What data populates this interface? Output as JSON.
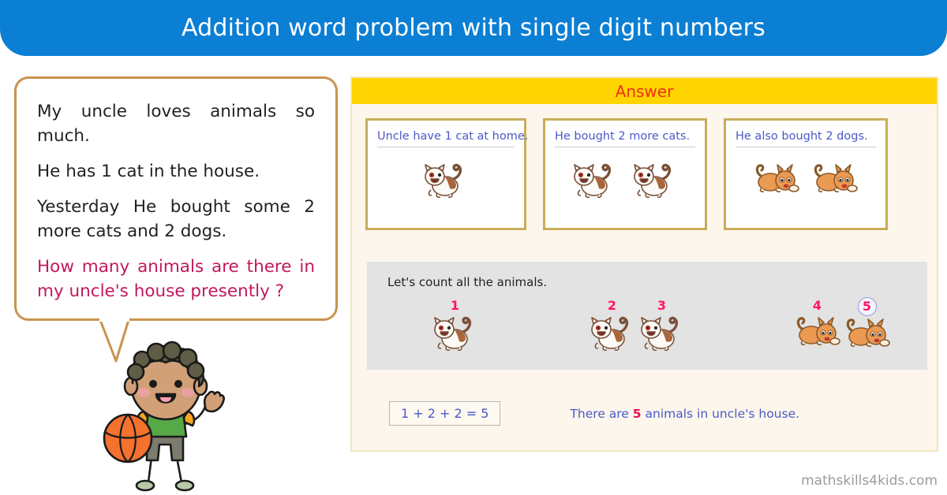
{
  "header": {
    "title": "Addition word problem with single digit numbers",
    "band_color": "#0b7fd4"
  },
  "problem": {
    "lines": [
      "My uncle loves animals so much.",
      "He has 1 cat in the house.",
      "Yesterday He bought some 2 more cats and 2 dogs."
    ],
    "question": "How many animals are there in my uncle's house presently ?",
    "question_color": "#c2185b",
    "bubble_border_color": "#c8944f"
  },
  "character": {
    "name": "boy-with-basketball",
    "hair_color": "#5f5d46",
    "skin_color": "#d2a077",
    "shirt_color": "#57a846",
    "sleeve_color": "#f5a623",
    "shorts_color": "#7d7a6e",
    "ball_color": "#f4712e",
    "cheek_color": "#e8a0a0"
  },
  "answer": {
    "title": "Answer",
    "title_color": "#f03010",
    "header_color": "#ffd400",
    "panel_color": "#fdf6ec",
    "steps": [
      {
        "caption": "Uncle have 1 cat at home.",
        "animal": "cat",
        "count": 1
      },
      {
        "caption": "He bought 2 more cats.",
        "animal": "cat",
        "count": 2
      },
      {
        "caption": "He also bought 2 dogs.",
        "animal": "dog",
        "count": 2
      }
    ],
    "count_section": {
      "label": "Let's count all the animals.",
      "box_color": "#e2e3e2",
      "number_color": "#ff1466",
      "groups": [
        {
          "animal": "cat",
          "numbers": [
            "1"
          ]
        },
        {
          "animal": "cat",
          "numbers": [
            "2",
            "3"
          ]
        },
        {
          "animal": "dog",
          "numbers": [
            "4",
            "5"
          ]
        }
      ],
      "circled_number": "5",
      "circle_color": "#9a9ae0"
    },
    "equation": "1 + 2 + 2 = 5",
    "conclusion_prefix": "There are ",
    "conclusion_number": "5",
    "conclusion_suffix": " animals in uncle's house.",
    "text_color": "#4a5ac8"
  },
  "footer": {
    "watermark": "mathskills4kids.com"
  }
}
